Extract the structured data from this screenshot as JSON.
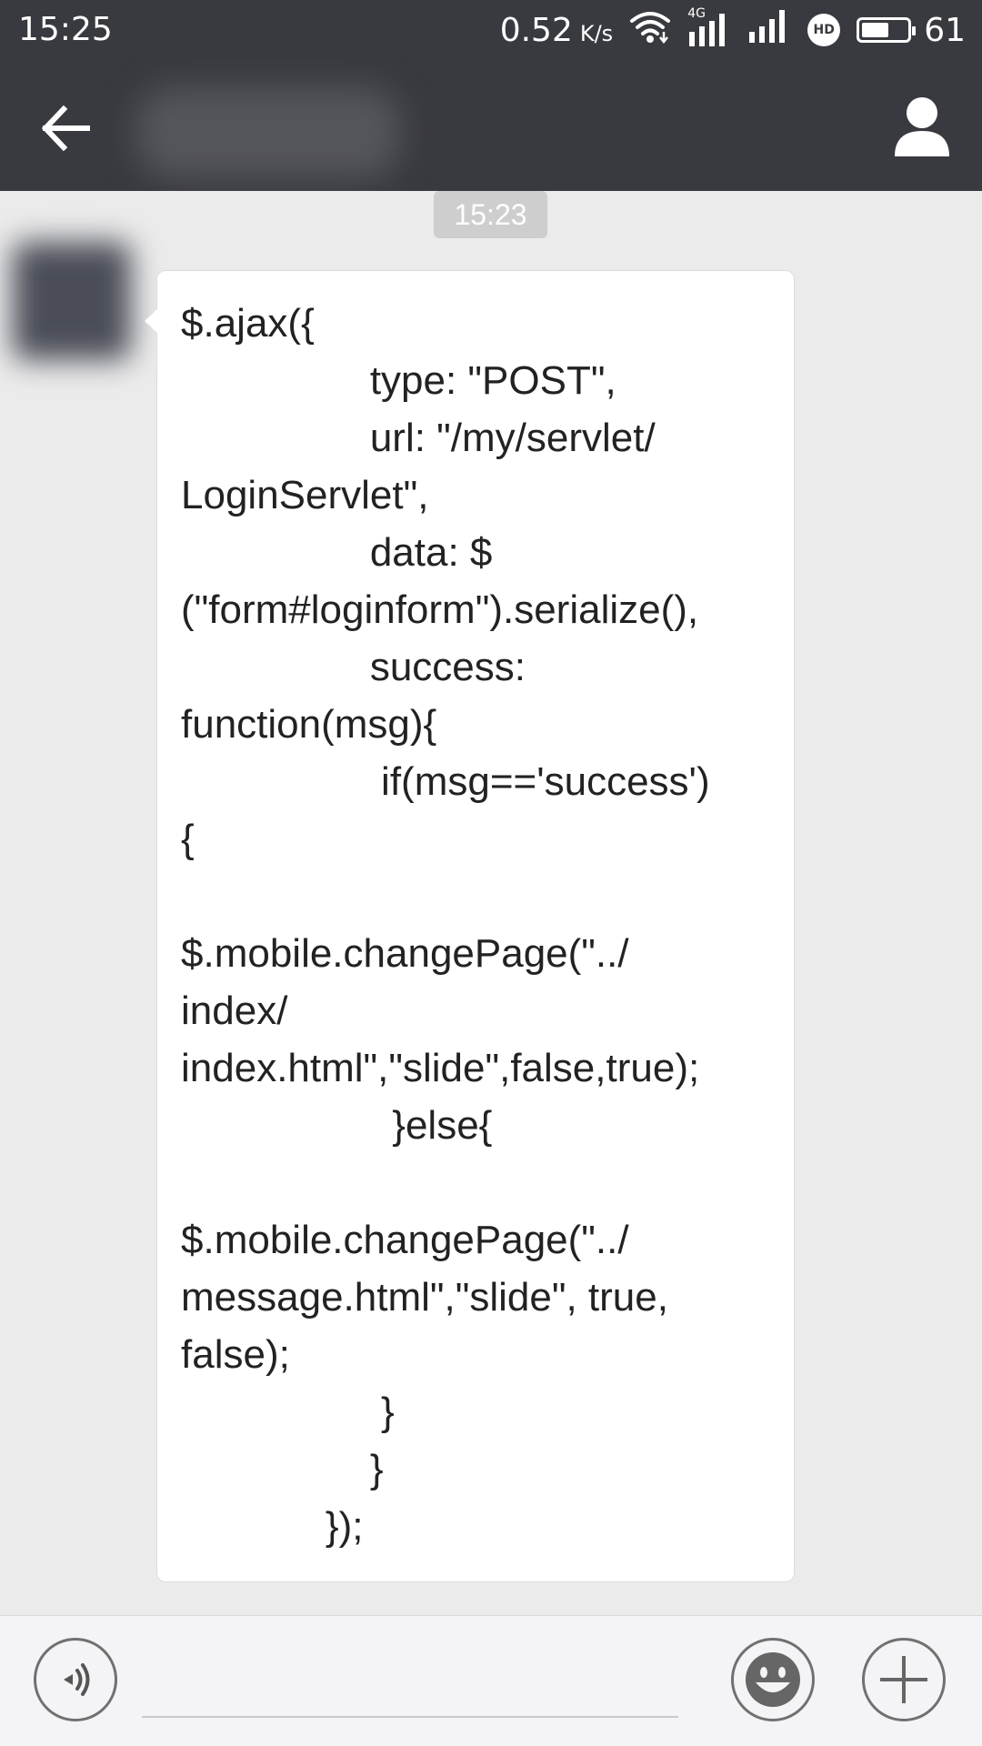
{
  "status_bar": {
    "time": "15:25",
    "network_speed": "0.52",
    "network_speed_unit": "K/s",
    "signal_label": "4G",
    "hd_label": "HD",
    "battery_level": 61,
    "battery_text": "61",
    "icons": [
      "wifi-icon",
      "signal-4g-icon",
      "signal-icon",
      "hd-voice-icon",
      "battery-icon"
    ]
  },
  "header": {
    "back_icon": "arrow-left-icon",
    "profile_icon": "person-icon"
  },
  "chat": {
    "timestamp": "15:23",
    "messages": [
      {
        "direction": "incoming",
        "text": "$.ajax({\n                 type: \"POST\",\n                 url: \"/my/servlet/\nLoginServlet\",\n                 data: $\n(\"form#loginform\").serialize(),\n                 success:\nfunction(msg){\n                  if(msg=='success')\n{\n\n$.mobile.changePage(\"../\nindex/\nindex.html\",\"slide\",false,true);\n                   }else{\n\n$.mobile.changePage(\"../\nmessage.html\",\"slide\", true,\nfalse);\n                  }\n                 }\n             });"
      }
    ]
  },
  "input_bar": {
    "voice_icon": "voice-icon",
    "emoji_icon": "emoji-icon",
    "plus_icon": "plus-icon",
    "input_value": ""
  },
  "colors": {
    "header_bg": "#393a3f",
    "chat_bg": "#ebebeb",
    "bubble_bg": "#ffffff",
    "timestamp_bg": "#cecece",
    "input_bar_bg": "#f4f4f6"
  }
}
